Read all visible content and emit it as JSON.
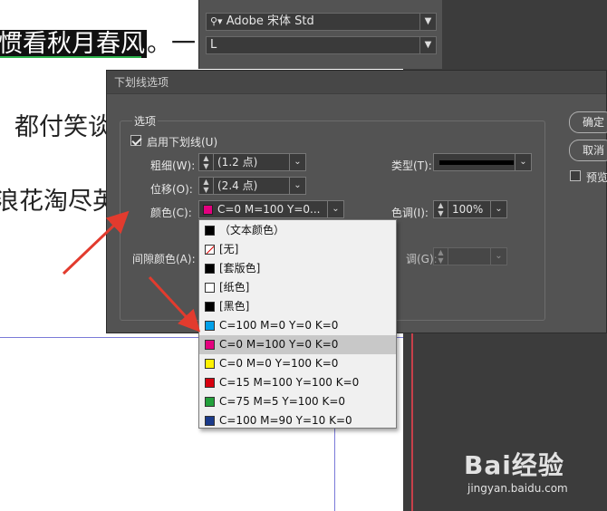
{
  "document": {
    "line1_highlight": "惯看秋月春风",
    "line1_tail": "。一",
    "line2": "都付笑谈",
    "line3": "浪花淘尽英"
  },
  "character_panel": {
    "font_family": "Adobe 宋体 Std",
    "font_style": "L"
  },
  "dialog": {
    "title": "下划线选项",
    "group_label": "选项",
    "enable_label": "启用下划线(U)",
    "enable_checked": true,
    "weight_label": "粗细(W):",
    "weight_value": "(1.2 点)",
    "offset_label": "位移(O):",
    "offset_value": "(2.4 点)",
    "color_label": "颜色(C):",
    "color_value": "C=0 M=100 Y=0...",
    "color_swatch": "#e4007f",
    "type_label": "类型(T):",
    "tint_label": "色调(I):",
    "tint_value": "100%",
    "gap_color_label": "间隙颜色(A):",
    "gap_tint_label": "调(G):",
    "ok_button": "确定",
    "cancel_button": "取消",
    "preview_label": "预览"
  },
  "color_list": {
    "items": [
      {
        "label": "（文本颜色）",
        "color": "#000000"
      },
      {
        "label": "[无]",
        "color": "none"
      },
      {
        "label": "[套版色]",
        "color": "#000000"
      },
      {
        "label": "[纸色]",
        "color": "#ffffff"
      },
      {
        "label": "[黑色]",
        "color": "#000000"
      },
      {
        "label": "C=100 M=0 Y=0 K=0",
        "color": "#00a0e9"
      },
      {
        "label": "C=0 M=100 Y=0 K=0",
        "color": "#e4007f",
        "selected": true
      },
      {
        "label": "C=0 M=0 Y=100 K=0",
        "color": "#fff100"
      },
      {
        "label": "C=15 M=100 Y=100 K=0",
        "color": "#d7000f"
      },
      {
        "label": "C=75 M=5 Y=100 K=0",
        "color": "#22a03b"
      },
      {
        "label": "C=100 M=90 Y=10 K=0",
        "color": "#1a3a8a"
      }
    ]
  },
  "watermark": {
    "logo": "Bai经验",
    "url": "jingyan.baidu.com"
  }
}
